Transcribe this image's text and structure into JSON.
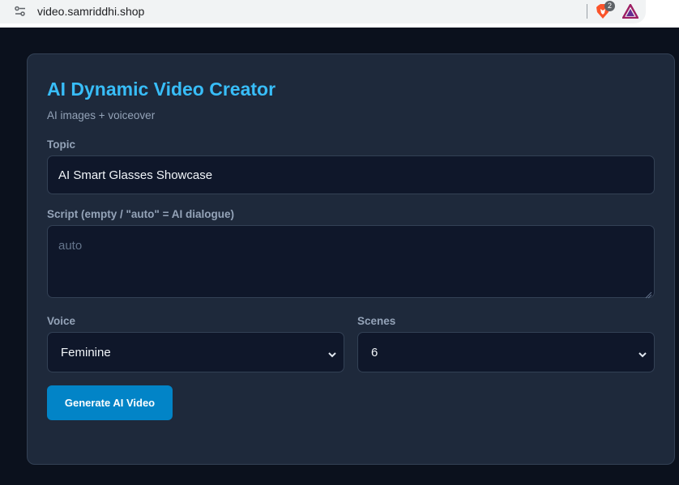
{
  "browser": {
    "url": "video.samriddhi.shop",
    "brave_badge_count": "2",
    "icons": [
      "site-info-icon",
      "brave-shields-icon",
      "brave-rewards-icon"
    ]
  },
  "app": {
    "title": "AI Dynamic Video Creator",
    "subtitle": "AI images + voiceover"
  },
  "form": {
    "topic": {
      "label": "Topic",
      "value": "AI Smart Glasses Showcase"
    },
    "script": {
      "label": "Script (empty / \"auto\" = AI dialogue)",
      "placeholder": "auto",
      "value": ""
    },
    "voice": {
      "label": "Voice",
      "selected": "Feminine"
    },
    "scenes": {
      "label": "Scenes",
      "selected": "6"
    },
    "submit_label": "Generate AI Video"
  },
  "colors": {
    "accent": "#38bdf8",
    "button": "#0284c7",
    "card": "#1e293b",
    "input": "#0f172a",
    "page": "#0b111d"
  }
}
